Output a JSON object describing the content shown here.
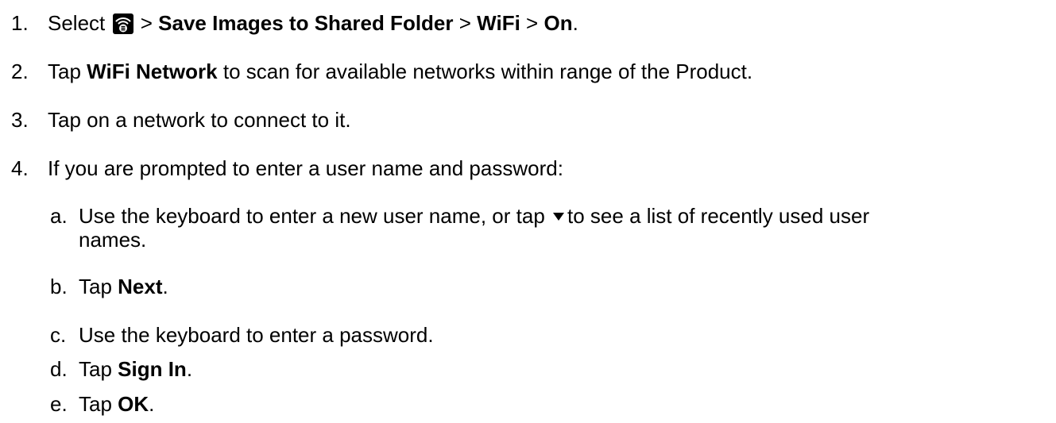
{
  "steps": [
    {
      "number": "1.",
      "parts": {
        "pre": "Select",
        "sep1": ">",
        "b1": "Save Images to Shared Folder",
        "sep2": ">",
        "b2": "WiFi",
        "sep3": ">",
        "b3": "On",
        "end": "."
      },
      "icon": "wifi-settings-icon"
    },
    {
      "number": "2.",
      "parts": {
        "pre": "Tap",
        "b1": "WiFi Network",
        "post": "to scan for available networks within range of the Product."
      }
    },
    {
      "number": "3.",
      "text": "Tap on a network to connect to it."
    },
    {
      "number": "4.",
      "text": "If you are prompted to enter a user name and password:"
    }
  ],
  "substeps": [
    {
      "letter": "a.",
      "line1_pre": "Use the keyboard to enter a new user name, or tap",
      "line1_post": "to see a list of recently used user",
      "line2": "names.",
      "icon": "dropdown-triangle-icon"
    },
    {
      "letter": "b.",
      "pre": "Tap",
      "bold": "Next",
      "end": "."
    },
    {
      "letter": "c.",
      "text": "Use the keyboard to enter a password."
    },
    {
      "letter": "d.",
      "pre": "Tap",
      "bold": "Sign In",
      "end": "."
    },
    {
      "letter": "e.",
      "pre": "Tap",
      "bold": "OK",
      "end": "."
    }
  ]
}
